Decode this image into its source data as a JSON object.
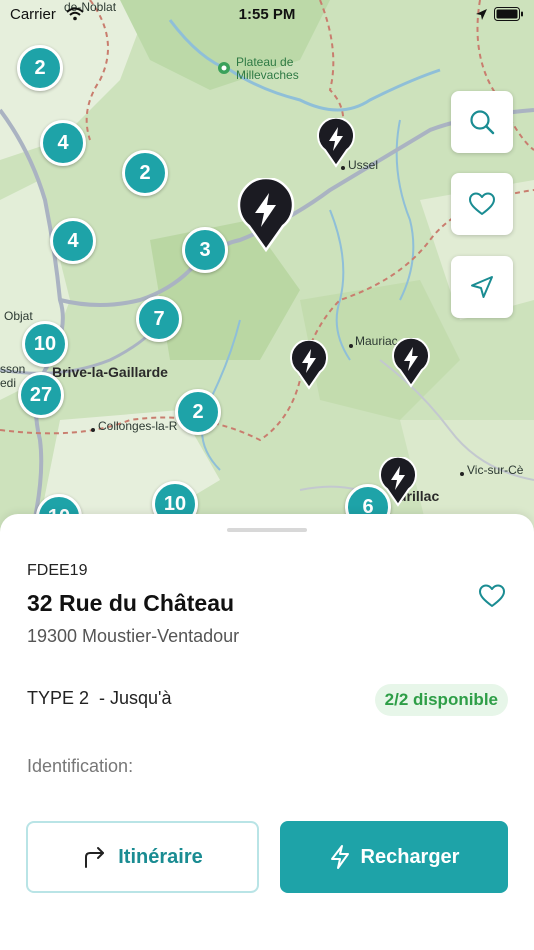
{
  "status_bar": {
    "carrier": "Carrier",
    "time": "1:55 PM"
  },
  "map": {
    "labels": {
      "plateau": "Plateau de\nMillevaches",
      "ussel": "Ussel",
      "objat": "Objat",
      "brive": "Brive-la-Gaillarde",
      "collonges": "Collonges-la-R",
      "mauriac": "Mauriac",
      "aurillac": "urillac",
      "vic": "Vic-sur-Cè",
      "noblat": "de-Noblat",
      "sson": "sson",
      "edi": "edi"
    },
    "clusters": [
      "2",
      "4",
      "2",
      "4",
      "3",
      "7",
      "10",
      "27",
      "2",
      "10",
      "10",
      "6"
    ]
  },
  "sheet": {
    "operator": "FDEE19",
    "title": "32 Rue du Château",
    "address": "19300 Moustier-Ventadour",
    "connector": "TYPE 2  - Jusqu'à",
    "availability": "2/2 disponible",
    "identification": "Identification:",
    "route_button": "Itinéraire",
    "charge_button": "Recharger"
  },
  "colors": {
    "accent": "#1ea3a8",
    "available": "#2e9e47",
    "map_green": "#cfe3bf"
  },
  "icons": [
    "search-icon",
    "heart-icon",
    "navigation-arrow-icon",
    "lightning-icon",
    "route-turn-icon",
    "wifi-icon",
    "battery-icon",
    "location-arrow-icon",
    "park-icon"
  ]
}
